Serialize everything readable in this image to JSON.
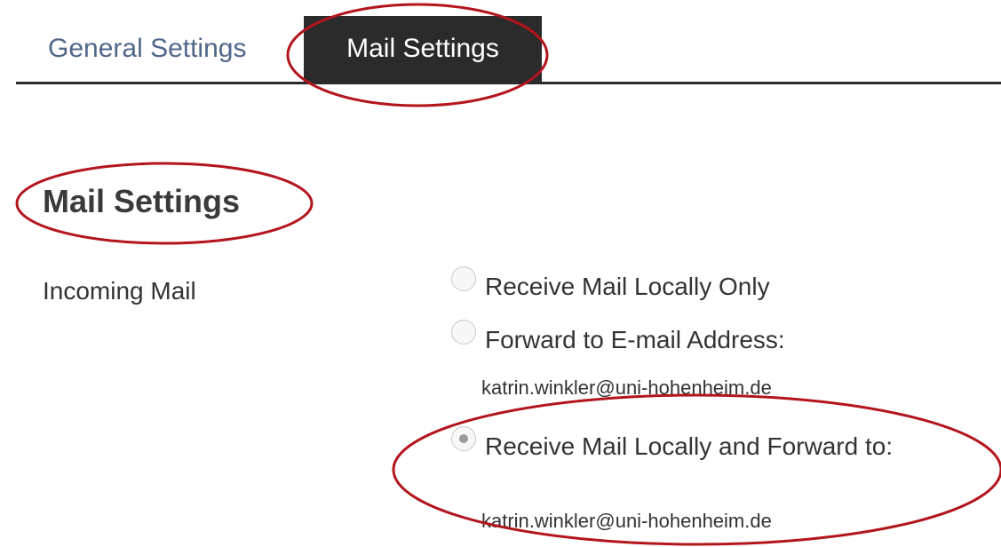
{
  "tabs": [
    {
      "label": "General Settings",
      "active": false
    },
    {
      "label": "Mail Settings",
      "active": true
    }
  ],
  "section_title": "Mail Settings",
  "incoming_mail": {
    "label": "Incoming Mail",
    "options": [
      {
        "label": "Receive Mail Locally Only",
        "selected": false
      },
      {
        "label": "Forward to E-mail Address:",
        "selected": false,
        "address": "katrin.winkler@uni-hohenheim.de"
      },
      {
        "label": "Receive Mail Locally and Forward to:",
        "selected": true,
        "address": "katrin.winkler@uni-hohenheim.de"
      }
    ]
  },
  "colors": {
    "active_tab_bg": "#2b2b2b",
    "inactive_tab_text": "#50678a",
    "annotation": "#b3151d"
  }
}
